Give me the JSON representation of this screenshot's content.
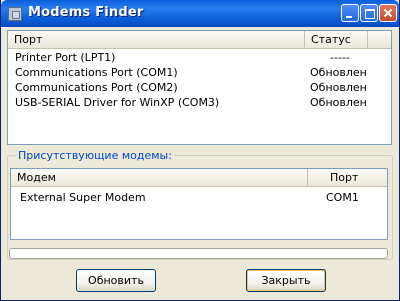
{
  "window": {
    "title": "Modems Finder"
  },
  "ports_list": {
    "columns": [
      "Порт",
      "Статус"
    ],
    "rows": [
      {
        "port": "Printer Port (LPT1)",
        "status": "-----"
      },
      {
        "port": "Communications Port (COM1)",
        "status": "Обновлен"
      },
      {
        "port": "Communications Port (COM2)",
        "status": "Обновлен"
      },
      {
        "port": "USB-SERIAL Driver for WinXP (COM3)",
        "status": "Обновлен"
      }
    ]
  },
  "modems_group": {
    "label": "Присутствующие модемы:",
    "columns": [
      "Модем",
      "Порт"
    ],
    "rows": [
      {
        "modem": "External Super Modem",
        "port": "COM1"
      }
    ]
  },
  "progress": {
    "value_percent": 0
  },
  "buttons": {
    "refresh": "Обновить",
    "close": "Закрыть"
  },
  "colors": {
    "titlebar": "#0a5fd9",
    "group_label": "#0046d5",
    "window_bg": "#ece9d8"
  }
}
